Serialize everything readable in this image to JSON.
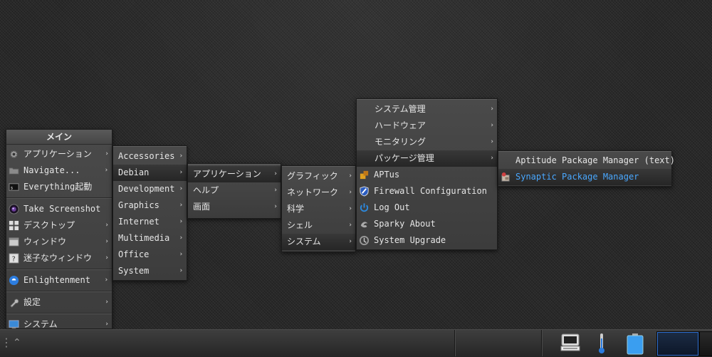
{
  "main_menu": {
    "title": "メイン",
    "items": [
      {
        "label": "アプリケーション",
        "icon": "gear-icon",
        "arrow": "›"
      },
      {
        "label": "Navigate...",
        "icon": "folder-icon",
        "arrow": "›"
      },
      {
        "label": "Everything起動",
        "icon": "terminal-icon"
      },
      {
        "label": "Take Screenshot",
        "icon": "camera-icon"
      },
      {
        "label": "デスクトップ",
        "icon": "desktop-grid-icon",
        "arrow": "›"
      },
      {
        "label": "ウィンドウ",
        "icon": "window-icon",
        "arrow": "›"
      },
      {
        "label": "迷子なウィンドウ",
        "icon": "question-icon",
        "arrow": "›"
      },
      {
        "label": "Enlightenment",
        "icon": "enlightenment-icon",
        "arrow": "›"
      },
      {
        "label": "設定",
        "icon": "wrench-icon",
        "arrow": "›"
      },
      {
        "label": "システム",
        "icon": "monitor-icon",
        "arrow": "›"
      }
    ]
  },
  "apps_menu": {
    "items": [
      "Accessories",
      "Debian",
      "Development",
      "Graphics",
      "Internet",
      "Multimedia",
      "Office",
      "System"
    ],
    "arrow": "›"
  },
  "debian_menu": {
    "items": [
      "アプリケーション",
      "ヘルプ",
      "画面"
    ],
    "arrow": "›"
  },
  "debian_apps_menu": {
    "items": [
      "グラフィック",
      "ネットワーク",
      "科学",
      "シェル",
      "システム"
    ],
    "arrow": "›"
  },
  "system_menu": {
    "submenus": [
      "システム管理",
      "ハードウェア",
      "モニタリング",
      "パッケージ管理"
    ],
    "apps": [
      {
        "label": "APTus",
        "icon": "aptus-icon"
      },
      {
        "label": "Firewall Configuration",
        "icon": "shield-icon"
      },
      {
        "label": "Log Out",
        "icon": "power-icon"
      },
      {
        "label": "Sparky About",
        "icon": "sparky-icon"
      },
      {
        "label": "System Upgrade",
        "icon": "upgrade-icon"
      }
    ],
    "arrow": "›"
  },
  "package_menu": {
    "items": [
      {
        "label": "Aptitude Package Manager (text)"
      },
      {
        "label": "Synaptic Package Manager",
        "icon": "synaptic-icon"
      }
    ]
  },
  "taskbar": {
    "menu_handle": "⋮",
    "up_arrow": "⌃",
    "accent": "#2f6fd0"
  }
}
